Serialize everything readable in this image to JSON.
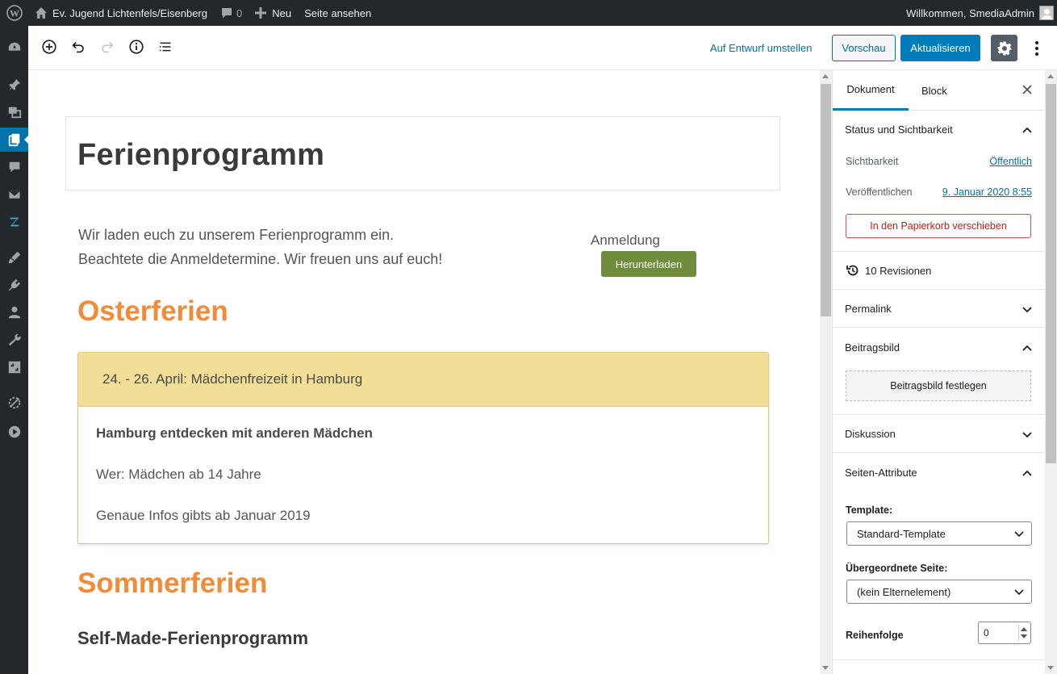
{
  "adminbar": {
    "site_name": "Ev. Jugend Lichtenfels/Eisenberg",
    "comments_count": "0",
    "new_label": "Neu",
    "view_page_label": "Seite ansehen",
    "welcome": "Willkommen, SmediaAdmin"
  },
  "admin_menu": {
    "icons": [
      "dashboard-icon",
      "posts-pin-icon",
      "media-icon",
      "pages-icon",
      "comments-icon",
      "mail-icon",
      "plugin-z-icon",
      "appearance-icon",
      "plugins-icon",
      "users-icon",
      "tools-icon",
      "settings-icon",
      "extra-plugin-icon",
      "play-icon"
    ],
    "current": "pages-icon"
  },
  "toolbar": {
    "draft_label": "Auf Entwurf umstellen",
    "preview_label": "Vorschau",
    "update_label": "Aktualisieren"
  },
  "post": {
    "title": "Ferienprogramm",
    "intro_line1": "Wir laden euch zu unserem Ferienprogramm ein.",
    "intro_line2": "Beachtete die Anmeldetermine. Wir freuen uns auf euch!",
    "anmeldung_label": "Anmeldung",
    "download_label": "Herunterladen",
    "section1_heading": "Osterferien",
    "accordion": {
      "title": "24. - 26. April: Mädchenfreizeit in Hamburg",
      "line1": "Hamburg entdecken mit anderen Mädchen",
      "line2": "Wer: Mädchen ab 14 Jahre",
      "line3": "Genaue Infos gibts ab Januar 2019"
    },
    "section2_heading": "Sommerferien",
    "sub_heading": "Self-Made-Ferienprogramm"
  },
  "sidebar": {
    "tab_document": "Dokument",
    "tab_block": "Block",
    "status_panel": "Status und Sichtbarkeit",
    "visibility_label": "Sichtbarkeit",
    "visibility_value": "Öffentlich",
    "publish_label": "Veröffentlichen",
    "publish_value": "9. Januar 2020 8:55",
    "trash_label": "In den Papierkorb verschieben",
    "revisions_label": "10 Revisionen",
    "permalink_panel": "Permalink",
    "featured_panel": "Beitragsbild",
    "featured_button": "Beitragsbild festlegen",
    "discussion_panel": "Diskussion",
    "attributes_panel": "Seiten-Attribute",
    "template_label": "Template:",
    "template_value": "Standard-Template",
    "parent_label": "Übergeordnete Seite:",
    "parent_value": "(kein Elternelement)",
    "order_label": "Reihenfolge",
    "order_value": "0"
  },
  "colors": {
    "accent": "#007cba",
    "season_heading": "#f28b37",
    "accordion_header": "#f1de97",
    "download_button": "#6e8c3b",
    "adminbar": "#23282d"
  }
}
